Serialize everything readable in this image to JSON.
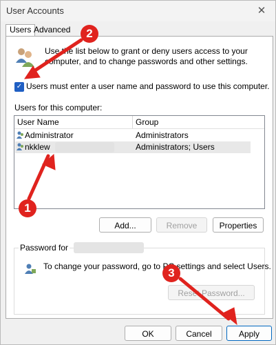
{
  "window": {
    "title": "User Accounts",
    "close_glyph": "✕"
  },
  "tabs": [
    {
      "label": "Users"
    },
    {
      "label": "Advanced"
    }
  ],
  "intro_text": "Use the list below to grant or deny users access to your computer, and to change passwords and other settings.",
  "must_enter_checkbox": {
    "label": "Users must enter a user name and password to use this computer.",
    "checked": true
  },
  "users_section_label": "Users for this computer:",
  "list": {
    "columns": [
      "User Name",
      "Group"
    ],
    "rows": [
      {
        "name": "Administrator",
        "group": "Administrators",
        "selected": false
      },
      {
        "name": "nkklew",
        "group": "Administrators; Users",
        "selected": true
      }
    ]
  },
  "buttons": {
    "add": "Add...",
    "remove": "Remove",
    "properties": "Properties"
  },
  "password_group": {
    "title": "Password for",
    "text": "To change your password, go to PC settings and select Users.",
    "reset_button": "Reset Password..."
  },
  "footer": {
    "ok": "OK",
    "cancel": "Cancel",
    "apply": "Apply"
  },
  "annotations": [
    "1",
    "2",
    "3"
  ],
  "colors": {
    "accent": "#1f5fc3",
    "annotation": "#e0231e"
  }
}
